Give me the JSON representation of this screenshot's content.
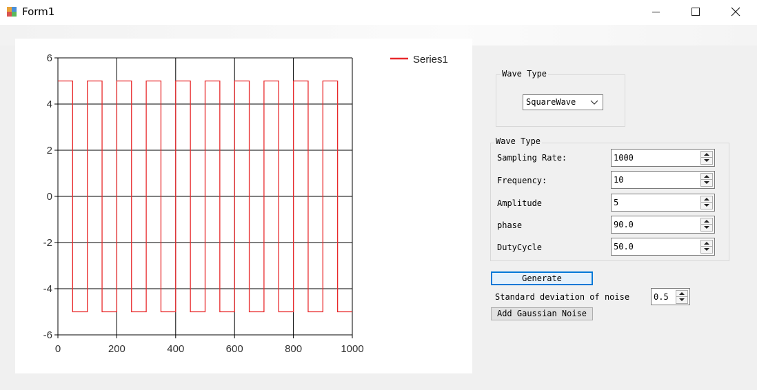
{
  "window": {
    "title": "Form1",
    "icon": "winforms-app-icon",
    "controls": [
      "minimize-icon",
      "maximize-icon",
      "close-icon"
    ]
  },
  "chart": {
    "legend_label": "Series1",
    "series_color": "#e8292b"
  },
  "chart_data": {
    "type": "line",
    "step": true,
    "title": "",
    "xlabel": "",
    "ylabel": "",
    "xlim": [
      0,
      1000
    ],
    "ylim": [
      -6,
      6
    ],
    "x_ticks": [
      "0",
      "200",
      "400",
      "600",
      "800",
      "1000"
    ],
    "y_ticks": [
      "6",
      "4",
      "2",
      "0",
      "-2",
      "-4",
      "-6"
    ],
    "grid": true,
    "legend_position": "top-right",
    "series": [
      {
        "name": "Series1",
        "color": "#e8292b",
        "x": [
          0,
          50,
          50,
          100,
          100,
          150,
          150,
          200,
          200,
          250,
          250,
          300,
          300,
          350,
          350,
          400,
          400,
          450,
          450,
          500,
          500,
          550,
          550,
          600,
          600,
          650,
          650,
          700,
          700,
          750,
          750,
          800,
          800,
          850,
          850,
          900,
          900,
          950,
          950,
          1000
        ],
        "y": [
          5,
          5,
          -5,
          -5,
          5,
          5,
          -5,
          -5,
          5,
          5,
          -5,
          -5,
          5,
          5,
          -5,
          -5,
          5,
          5,
          -5,
          -5,
          5,
          5,
          -5,
          -5,
          5,
          5,
          -5,
          -5,
          5,
          5,
          -5,
          -5,
          5,
          5,
          -5,
          -5,
          5,
          5,
          -5,
          -5
        ]
      }
    ]
  },
  "wave_group": {
    "title": "Wave Type",
    "selected": "SquareWave",
    "dropdown_icon": "chevron-down-icon"
  },
  "params_group": {
    "title": "Wave Type",
    "fields": [
      {
        "label": "Sampling Rate:",
        "value": "1000"
      },
      {
        "label": "Frequency:",
        "value": "10"
      },
      {
        "label": "Amplitude",
        "value": "5"
      },
      {
        "label": "phase",
        "value": "90.0"
      },
      {
        "label": "DutyCycle",
        "value": "50.0"
      }
    ]
  },
  "generate_button": "Generate",
  "noise": {
    "label": "Standard deviation of noise",
    "value": "0.5",
    "button": "Add Gaussian Noise"
  }
}
